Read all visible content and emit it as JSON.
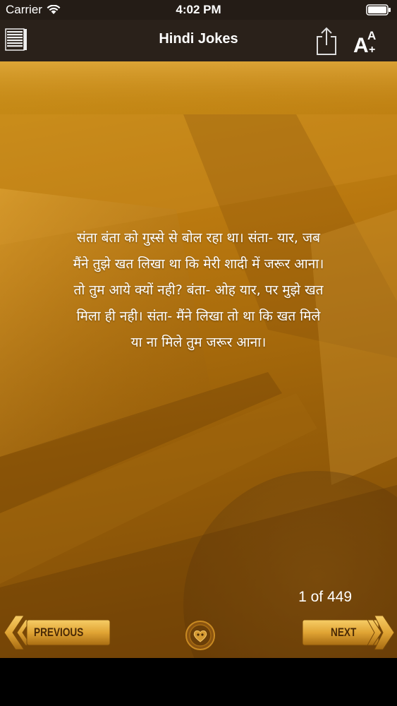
{
  "status_bar": {
    "carrier": "Carrier",
    "time": "4:02 PM"
  },
  "nav": {
    "title": "Hindi Jokes",
    "menu_icon": "list-menu-icon",
    "share_icon": "share-icon",
    "font_icon": "font-size-icon",
    "font_icon_text": "A",
    "font_icon_superscript": "A",
    "font_icon_plus": "+"
  },
  "joke": {
    "lines": [
      "संता बंता को गुस्से से बोल रहा था। संता- यार, जब",
      "मैंने तुझे खत लिखा था कि मेरी शादी में जरूर आना।",
      "तो तुम आये क्यों नही? बंता- ओह यार, पर मुझे खत",
      "मिला ही नही। संता- मैंने लिखा तो था कि खत मिले",
      "या ना मिले तुम जरूर आना।"
    ]
  },
  "pagination": {
    "counter": "1 of 449"
  },
  "controls": {
    "previous_label": "PREVIOUS",
    "next_label": "NEXT",
    "favorite_icon": "heart-icon"
  },
  "colors": {
    "bar_background": "#2a211a",
    "content_gold": "#b9780f",
    "button_gold": "#e0a434"
  }
}
